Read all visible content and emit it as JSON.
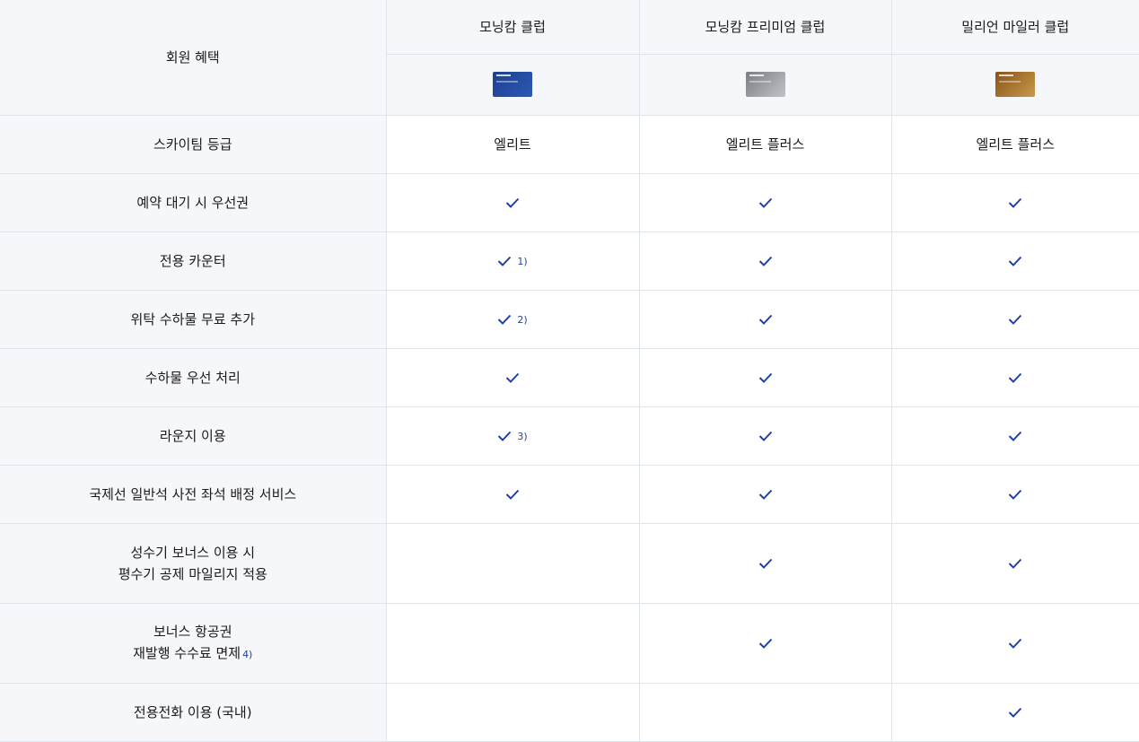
{
  "header": {
    "benefit_label": "회원 혜택",
    "columns": [
      "모닝캄 클럽",
      "모닝캄 프리미엄 클럽",
      "밀리언 마일러 클럽"
    ]
  },
  "cards": [
    {
      "name": "morning-calm-card",
      "color": "#24479f"
    },
    {
      "name": "morning-calm-premium-card",
      "color": "#9ea1a6"
    },
    {
      "name": "million-miler-card",
      "color": "#a8762e"
    }
  ],
  "rows": [
    {
      "label": "스카이팀 등급",
      "values": [
        "엘리트",
        "엘리트 플러스",
        "엘리트 플러스"
      ]
    },
    {
      "label": "예약 대기 시 우선권",
      "checks": [
        true,
        true,
        true
      ]
    },
    {
      "label": "전용 카운터",
      "checks": [
        true,
        true,
        true
      ],
      "note": "1)"
    },
    {
      "label": "위탁 수하물 무료 추가",
      "checks": [
        true,
        true,
        true
      ],
      "note": "2)"
    },
    {
      "label": "수하물 우선 처리",
      "checks": [
        true,
        true,
        true
      ]
    },
    {
      "label": "라운지 이용",
      "checks": [
        true,
        true,
        true
      ],
      "note": "3)"
    },
    {
      "label": "국제선 일반석 사전 좌석 배정 서비스",
      "checks": [
        true,
        true,
        true
      ]
    },
    {
      "label_line1": "성수기 보너스 이용 시",
      "label_line2": "평수기 공제 마일리지 적용",
      "checks": [
        false,
        true,
        true
      ]
    },
    {
      "label_line1": "보너스 항공권",
      "label_line2": "재발행 수수료 면제",
      "label_note": "4)",
      "checks": [
        false,
        true,
        true
      ]
    },
    {
      "label": "전용전화 이용 (국내)",
      "checks": [
        false,
        false,
        true
      ]
    }
  ],
  "colors": {
    "check": "#1f3fa8",
    "header_bg": "#f6f7fb",
    "border": "#dfe3ea"
  }
}
